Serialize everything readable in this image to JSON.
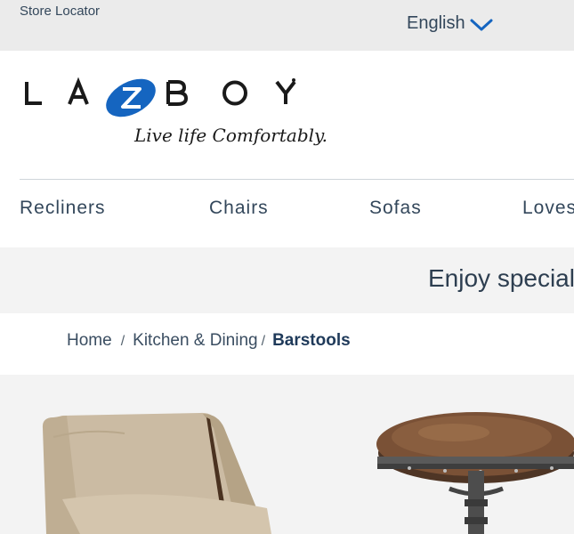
{
  "header": {
    "store_locator": "Store Locator",
    "language": "English"
  },
  "brand": {
    "name": "LA-Z-BOY",
    "tagline": "Live life Comfortably."
  },
  "nav": {
    "items": [
      {
        "label": "Recliners"
      },
      {
        "label": "Chairs"
      },
      {
        "label": "Sofas"
      },
      {
        "label": "Loveseats"
      }
    ]
  },
  "promo": {
    "text": "Enjoy special"
  },
  "breadcrumb": {
    "home": "Home",
    "category": "Kitchen & Dining",
    "current": "Barstools"
  },
  "colors": {
    "accent_blue": "#1565c0",
    "topbar_bg": "#ebebeb",
    "text": "#33475b"
  }
}
